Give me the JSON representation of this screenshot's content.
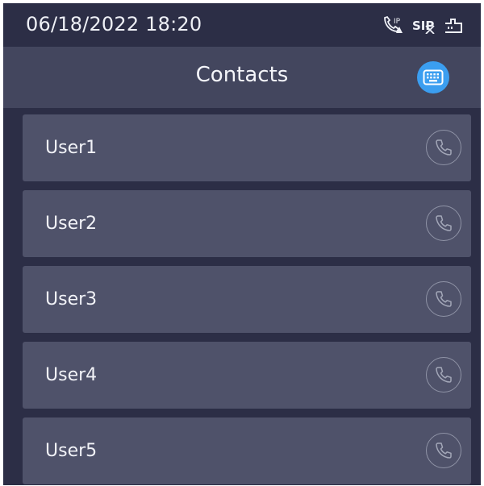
{
  "status_bar": {
    "datetime": "06/18/2022 18:20",
    "icons": [
      "ip-call-warning-icon",
      "sip-disabled-icon",
      "network-icon"
    ],
    "icon_labels": {
      "ip": "IP",
      "sip": "SIP"
    }
  },
  "header": {
    "title": "Contacts",
    "keyboard_icon": "keyboard-icon",
    "accent_color": "#3b9ef0"
  },
  "contacts": [
    {
      "name": "User1",
      "action_icon": "phone-icon"
    },
    {
      "name": "User2",
      "action_icon": "phone-icon"
    },
    {
      "name": "User3",
      "action_icon": "phone-icon"
    },
    {
      "name": "User4",
      "action_icon": "phone-icon"
    },
    {
      "name": "User5",
      "action_icon": "phone-icon"
    }
  ]
}
